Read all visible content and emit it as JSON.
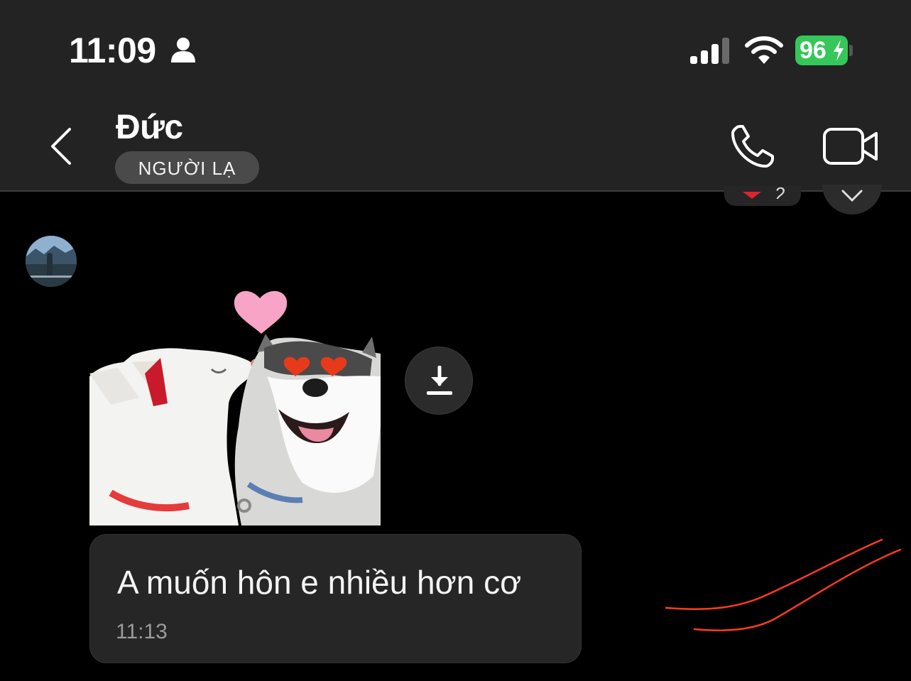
{
  "status_bar": {
    "time": "11:09",
    "battery": "96",
    "icons": [
      "person-icon",
      "signal-icon",
      "wifi-icon",
      "battery-icon"
    ],
    "battery_color": "#35c759"
  },
  "header": {
    "contact_name": "Đức",
    "badge": "NGƯỜI LẠ",
    "icons": [
      "back-icon",
      "phone-icon",
      "video-camera-icon"
    ]
  },
  "peek": {
    "reaction_count": "2"
  },
  "conversation": {
    "sticker_description_icon": "download-icon",
    "message": {
      "text": "A muốn hôn e nhiều hơn cơ",
      "time": "11:13"
    }
  },
  "colors": {
    "background": "#000000",
    "header": "#232323",
    "bubble": "#262626",
    "annotation": "#ff3b1f"
  }
}
